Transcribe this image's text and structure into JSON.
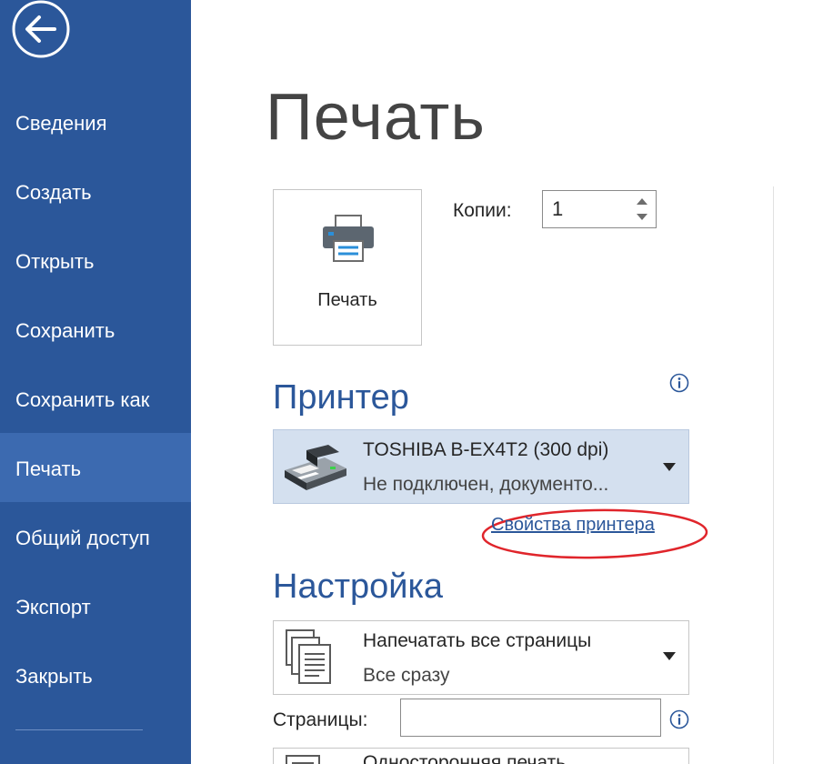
{
  "sidebar": {
    "back_icon": "back-arrow-icon",
    "items": [
      {
        "label": "Сведения"
      },
      {
        "label": "Создать"
      },
      {
        "label": "Открыть"
      },
      {
        "label": "Сохранить"
      },
      {
        "label": "Сохранить как"
      },
      {
        "label": "Печать",
        "active": true
      },
      {
        "label": "Общий доступ"
      },
      {
        "label": "Экспорт"
      },
      {
        "label": "Закрыть"
      }
    ],
    "colors": {
      "background": "#2b579a",
      "active": "#3c6ab0"
    }
  },
  "main": {
    "title": "Печать",
    "print_button": {
      "label": "Печать",
      "icon": "printer-icon"
    },
    "copies": {
      "label": "Копии:",
      "value": "1"
    },
    "printer": {
      "heading": "Принтер",
      "info_icon": "info-icon",
      "name": "TOSHIBA B-EX4T2 (300 dpi)",
      "status": "Не подключен, документо...",
      "properties_link": "Свойства принтера"
    },
    "settings": {
      "heading": "Настройка",
      "range": {
        "main": "Напечатать все страницы",
        "sub": "Все сразу"
      },
      "pages_label": "Страницы:",
      "pages_value": "",
      "sides_partial": "Односторонняя печать"
    },
    "colors": {
      "accent": "#2b579a",
      "selected_bg": "#d4e0ef",
      "highlight": "#e0252b"
    }
  }
}
